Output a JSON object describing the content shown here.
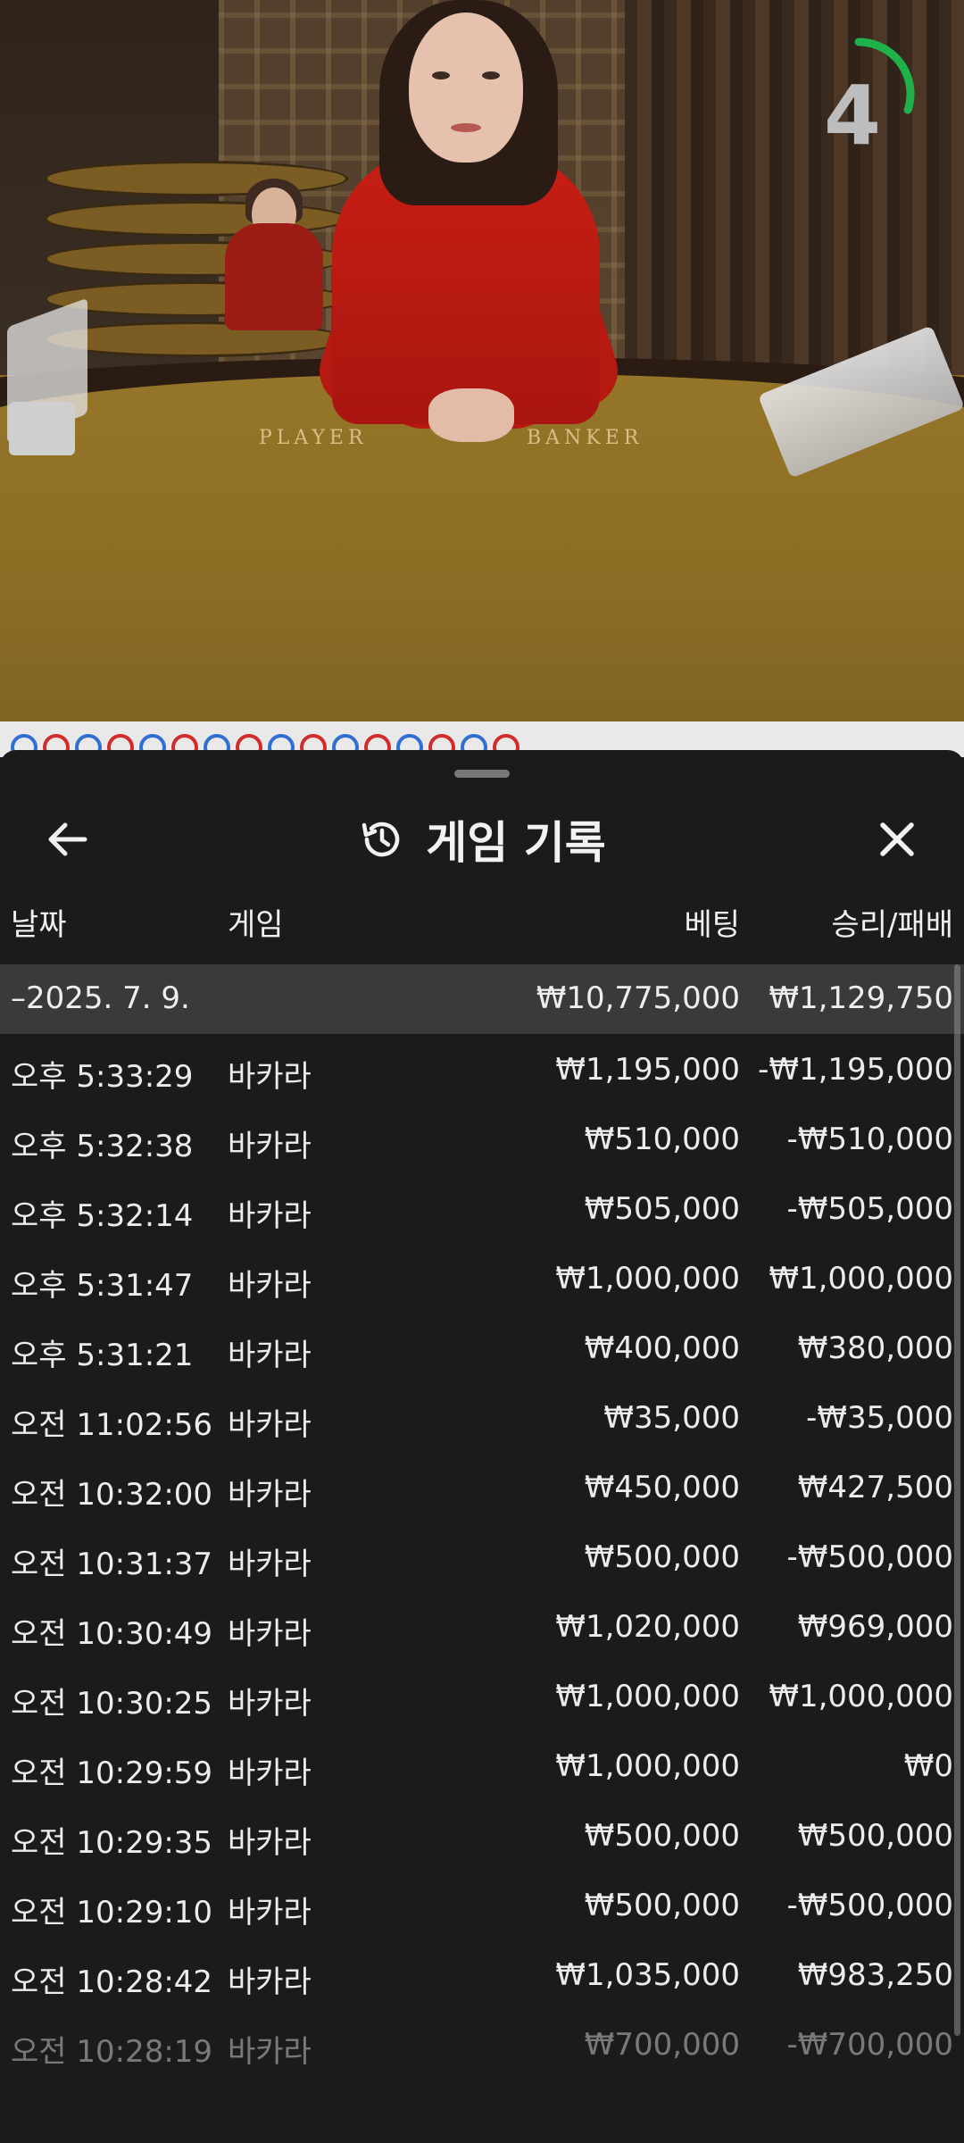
{
  "video": {
    "table_labels": {
      "player": "PLAYER",
      "banker": "BANKER"
    }
  },
  "timer": {
    "value": "4",
    "ring_color": "#1fb14a",
    "progress": 0.3
  },
  "road": {
    "colors": {
      "banker": "#d22b2b",
      "player": "#2f6fd1"
    },
    "sequence": [
      "player",
      "banker",
      "player",
      "banker",
      "player",
      "banker",
      "player",
      "banker",
      "player",
      "banker",
      "player",
      "banker",
      "player",
      "banker",
      "player",
      "banker"
    ]
  },
  "sheet": {
    "title": "게임 기록",
    "icons": {
      "back": "arrow-left-icon",
      "history": "history-icon",
      "close": "close-icon"
    },
    "columns": {
      "date": "날짜",
      "game": "게임",
      "bet": "베팅",
      "result": "승리/패배"
    },
    "summary": {
      "date": "–2025. 7. 9.",
      "bet": "₩10,775,000",
      "result": "₩1,129,750"
    },
    "rows": [
      {
        "time": "오후 5:33:29",
        "game": "바카라",
        "bet": "₩1,195,000",
        "result": "-₩1,195,000"
      },
      {
        "time": "오후 5:32:38",
        "game": "바카라",
        "bet": "₩510,000",
        "result": "-₩510,000"
      },
      {
        "time": "오후 5:32:14",
        "game": "바카라",
        "bet": "₩505,000",
        "result": "-₩505,000"
      },
      {
        "time": "오후 5:31:47",
        "game": "바카라",
        "bet": "₩1,000,000",
        "result": "₩1,000,000"
      },
      {
        "time": "오후 5:31:21",
        "game": "바카라",
        "bet": "₩400,000",
        "result": "₩380,000"
      },
      {
        "time": "오전 11:02:56",
        "game": "바카라",
        "bet": "₩35,000",
        "result": "-₩35,000"
      },
      {
        "time": "오전 10:32:00",
        "game": "바카라",
        "bet": "₩450,000",
        "result": "₩427,500"
      },
      {
        "time": "오전 10:31:37",
        "game": "바카라",
        "bet": "₩500,000",
        "result": "-₩500,000"
      },
      {
        "time": "오전 10:30:49",
        "game": "바카라",
        "bet": "₩1,020,000",
        "result": "₩969,000"
      },
      {
        "time": "오전 10:30:25",
        "game": "바카라",
        "bet": "₩1,000,000",
        "result": "₩1,000,000"
      },
      {
        "time": "오전 10:29:59",
        "game": "바카라",
        "bet": "₩1,000,000",
        "result": "₩0"
      },
      {
        "time": "오전 10:29:35",
        "game": "바카라",
        "bet": "₩500,000",
        "result": "₩500,000"
      },
      {
        "time": "오전 10:29:10",
        "game": "바카라",
        "bet": "₩500,000",
        "result": "-₩500,000"
      },
      {
        "time": "오전 10:28:42",
        "game": "바카라",
        "bet": "₩1,035,000",
        "result": "₩983,250"
      },
      {
        "time": "오전 10:28:19",
        "game": "바카라",
        "bet": "₩700,000",
        "result": "-₩700,000"
      }
    ]
  }
}
